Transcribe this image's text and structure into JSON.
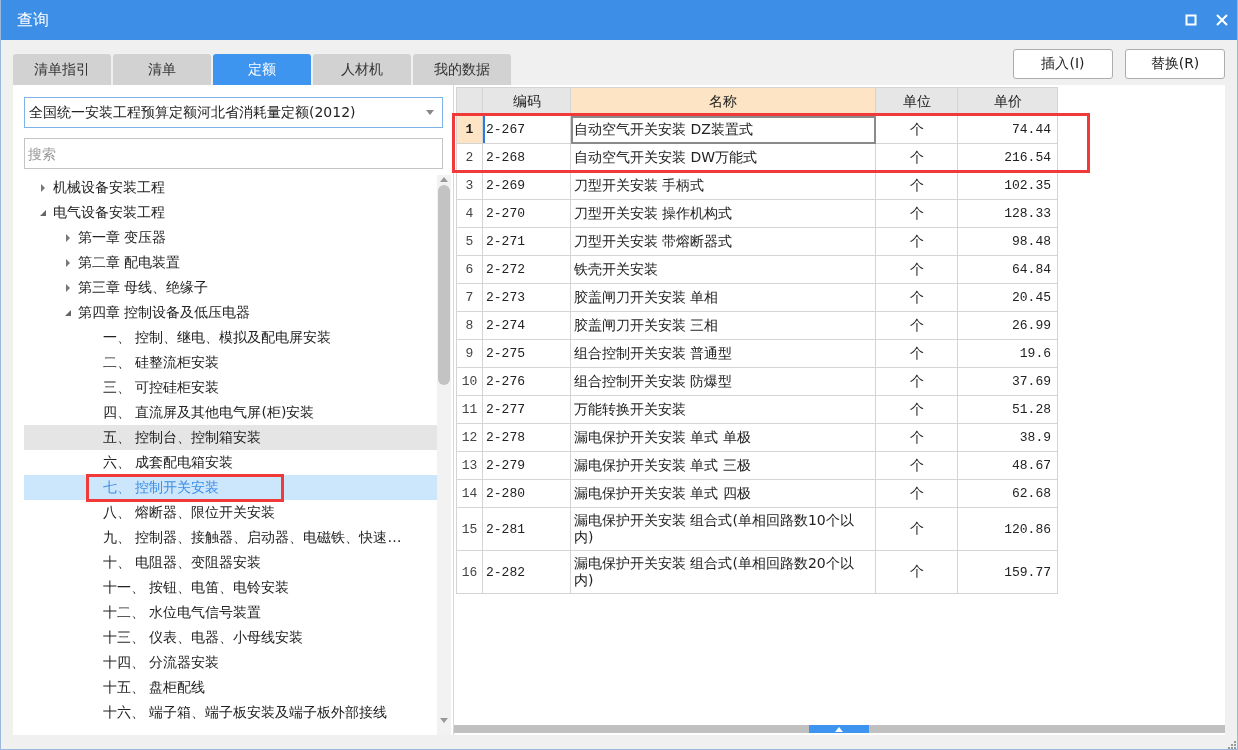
{
  "window": {
    "title": "查询"
  },
  "tabs": [
    {
      "label": "清单指引",
      "selected": false
    },
    {
      "label": "清单",
      "selected": false
    },
    {
      "label": "定额",
      "selected": true
    },
    {
      "label": "人材机",
      "selected": false
    },
    {
      "label": "我的数据",
      "selected": false
    }
  ],
  "buttons": [
    "插入(I)",
    "替换(R)"
  ],
  "library_select": {
    "value": "全国统一安装工程预算定额河北省消耗量定额(2012)"
  },
  "search": {
    "placeholder": "搜索"
  },
  "tree": [
    {
      "label": "机械设备安装工程",
      "expanded": false,
      "selected": false,
      "hovered": false
    },
    {
      "label": "电气设备安装工程",
      "expanded": true,
      "selected": false,
      "hovered": false,
      "children": [
        {
          "label": "第一章 变压器",
          "expanded": false,
          "selected": false,
          "hovered": false
        },
        {
          "label": "第二章 配电装置",
          "expanded": false,
          "selected": false,
          "hovered": false
        },
        {
          "label": "第三章 母线、绝缘子",
          "expanded": false,
          "selected": false,
          "hovered": false
        },
        {
          "label": "第四章 控制设备及低压电器",
          "expanded": true,
          "selected": false,
          "hovered": false,
          "children": [
            {
              "label": "一、  控制、继电、模拟及配电屏安装",
              "selected": false,
              "hovered": false
            },
            {
              "label": "二、  硅整流柜安装",
              "selected": false,
              "hovered": false
            },
            {
              "label": "三、  可控硅柜安装",
              "selected": false,
              "hovered": false
            },
            {
              "label": "四、  直流屏及其他电气屏(柜)安装",
              "selected": false,
              "hovered": false
            },
            {
              "label": "五、  控制台、控制箱安装",
              "selected": false,
              "hovered": true
            },
            {
              "label": "六、  成套配电箱安装",
              "selected": false,
              "hovered": false
            },
            {
              "label": "七、  控制开关安装",
              "selected": true,
              "hovered": false
            },
            {
              "label": "八、  熔断器、限位开关安装",
              "selected": false,
              "hovered": false
            },
            {
              "label": "九、  控制器、接触器、启动器、电磁铁、快速…",
              "selected": false,
              "hovered": false
            },
            {
              "label": "十、  电阻器、变阻器安装",
              "selected": false,
              "hovered": false
            },
            {
              "label": "十一、  按钮、电笛、电铃安装",
              "selected": false,
              "hovered": false
            },
            {
              "label": "十二、  水位电气信号装置",
              "selected": false,
              "hovered": false
            },
            {
              "label": "十三、  仪表、电器、小母线安装",
              "selected": false,
              "hovered": false
            },
            {
              "label": "十四、  分流器安装",
              "selected": false,
              "hovered": false
            },
            {
              "label": "十五、  盘柜配线",
              "selected": false,
              "hovered": false
            },
            {
              "label": "十六、  端子箱、端子板安装及端子板外部接线",
              "selected": false,
              "hovered": false
            }
          ]
        }
      ]
    }
  ],
  "table": {
    "columns": [
      {
        "label": "编码",
        "selected": false
      },
      {
        "label": "名称",
        "selected": true
      },
      {
        "label": "单位",
        "selected": false
      },
      {
        "label": "单价",
        "selected": false
      }
    ],
    "rows": [
      {
        "number": "1",
        "code": "2-267",
        "name": "自动空气开关安装 DZ装置式",
        "unit": "个",
        "price": "74.44",
        "selected": true
      },
      {
        "number": "2",
        "code": "2-268",
        "name": "自动空气开关安装 DW万能式",
        "unit": "个",
        "price": "216.54",
        "selected": false
      },
      {
        "number": "3",
        "code": "2-269",
        "name": "刀型开关安装 手柄式",
        "unit": "个",
        "price": "102.35",
        "selected": false
      },
      {
        "number": "4",
        "code": "2-270",
        "name": "刀型开关安装 操作机构式",
        "unit": "个",
        "price": "128.33",
        "selected": false
      },
      {
        "number": "5",
        "code": "2-271",
        "name": "刀型开关安装 带熔断器式",
        "unit": "个",
        "price": "98.48",
        "selected": false
      },
      {
        "number": "6",
        "code": "2-272",
        "name": "铁壳开关安装",
        "unit": "个",
        "price": "64.84",
        "selected": false
      },
      {
        "number": "7",
        "code": "2-273",
        "name": "胶盖闸刀开关安装 单相",
        "unit": "个",
        "price": "20.45",
        "selected": false
      },
      {
        "number": "8",
        "code": "2-274",
        "name": "胶盖闸刀开关安装 三相",
        "unit": "个",
        "price": "26.99",
        "selected": false
      },
      {
        "number": "9",
        "code": "2-275",
        "name": "组合控制开关安装 普通型",
        "unit": "个",
        "price": "19.6",
        "selected": false
      },
      {
        "number": "10",
        "code": "2-276",
        "name": "组合控制开关安装 防爆型",
        "unit": "个",
        "price": "37.69",
        "selected": false
      },
      {
        "number": "11",
        "code": "2-277",
        "name": "万能转换开关安装",
        "unit": "个",
        "price": "51.28",
        "selected": false
      },
      {
        "number": "12",
        "code": "2-278",
        "name": "漏电保护开关安装 单式 单极",
        "unit": "个",
        "price": "38.9",
        "selected": false
      },
      {
        "number": "13",
        "code": "2-279",
        "name": "漏电保护开关安装 单式 三极",
        "unit": "个",
        "price": "48.67",
        "selected": false
      },
      {
        "number": "14",
        "code": "2-280",
        "name": "漏电保护开关安装 单式 四极",
        "unit": "个",
        "price": "62.68",
        "selected": false
      },
      {
        "number": "15",
        "code": "2-281",
        "name": "漏电保护开关安装 组合式(单相回路数10个以内)",
        "unit": "个",
        "price": "120.86",
        "selected": false
      },
      {
        "number": "16",
        "code": "2-282",
        "name": "漏电保护开关安装 组合式(单相回路数20个以内)",
        "unit": "个",
        "price": "159.77",
        "selected": false
      }
    ]
  }
}
